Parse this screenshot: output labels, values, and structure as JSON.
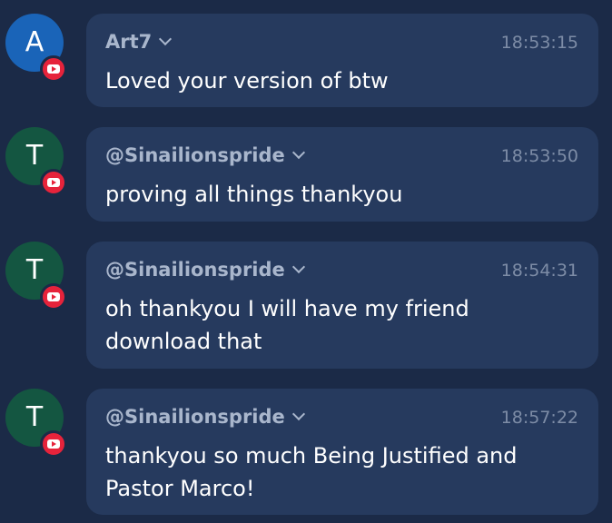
{
  "colors": {
    "background": "#1b2a47",
    "bubble": "#263a5e",
    "author_text": "#a9b6cc",
    "timestamp_text": "#7d8ca6",
    "message_text": "#ffffff",
    "youtube_badge": "#e6233b"
  },
  "messages": [
    {
      "avatar_letter": "A",
      "avatar_color": "#1a64b8",
      "source_icon": "youtube-icon",
      "author": "Art7",
      "time": "18:53:15",
      "text": "Loved your version of btw"
    },
    {
      "avatar_letter": "T",
      "avatar_color": "#145641",
      "source_icon": "youtube-icon",
      "author": "@Sinailionspride",
      "time": "18:53:50",
      "text": "proving all things thankyou"
    },
    {
      "avatar_letter": "T",
      "avatar_color": "#145641",
      "source_icon": "youtube-icon",
      "author": "@Sinailionspride",
      "time": "18:54:31",
      "text": "oh thankyou I will have my friend download that"
    },
    {
      "avatar_letter": "T",
      "avatar_color": "#145641",
      "source_icon": "youtube-icon",
      "author": "@Sinailionspride",
      "time": "18:57:22",
      "text": "thankyou so much Being Justified and Pastor Marco!"
    }
  ]
}
